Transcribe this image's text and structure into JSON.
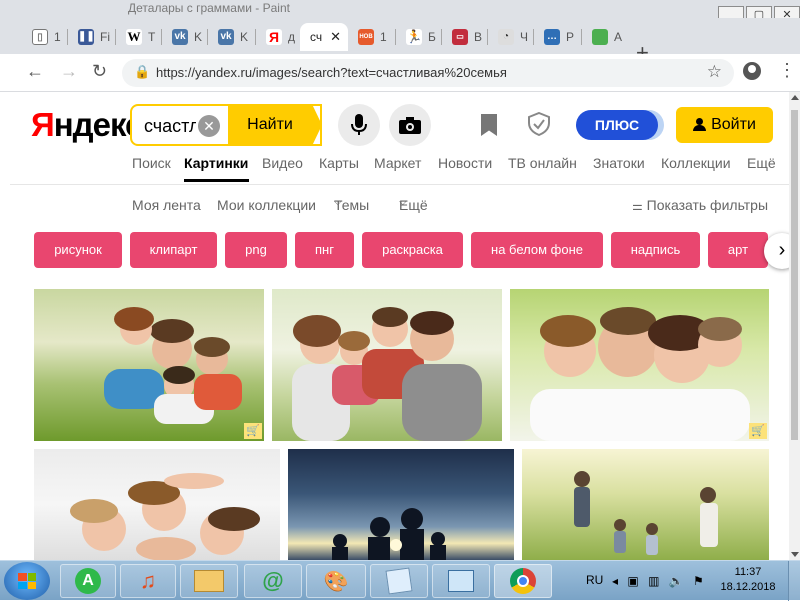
{
  "window": {
    "title_fragment": "Деталары с граммами - Paint",
    "controls": [
      "_",
      "▢",
      "✕"
    ]
  },
  "tabs": [
    {
      "label": "1",
      "icon": "document-icon",
      "color": "#777777"
    },
    {
      "label": "Fi",
      "icon": "pause-icon",
      "color": "#3b5998"
    },
    {
      "label": "T",
      "icon": "wikipedia-icon",
      "color": "#000000"
    },
    {
      "label": "K",
      "icon": "vk-icon",
      "color": "#4a76a8"
    },
    {
      "label": "K",
      "icon": "vk-icon",
      "color": "#4a76a8"
    },
    {
      "label": "д",
      "icon": "yandex-icon",
      "color": "#ff0000"
    },
    {
      "label": "сч",
      "icon": "",
      "color": "#ffffff",
      "active": true
    },
    {
      "label": "1",
      "icon": "news-icon",
      "color": "#e65a2c"
    },
    {
      "label": "Б",
      "icon": "runner-icon",
      "color": "#111111"
    },
    {
      "label": "В",
      "icon": "tv-icon",
      "color": "#c22d3d"
    },
    {
      "label": "Ч",
      "icon": "wolf-icon",
      "color": "#555555"
    },
    {
      "label": "Р",
      "icon": "chat-icon",
      "color": "#2f6fb6"
    },
    {
      "label": "А",
      "icon": "green-square-icon",
      "color": "#4caf50"
    }
  ],
  "address_bar": {
    "url": "https://yandex.ru/images/search?text=счастливая%20семья"
  },
  "header": {
    "logo_first": "Я",
    "logo_rest": "ндекс",
    "search_query": "счастл",
    "find_label": "Найти",
    "plus_label": "ПЛЮС",
    "login_label": "Войти"
  },
  "services": [
    {
      "label": "Поиск"
    },
    {
      "label": "Картинки",
      "active": true
    },
    {
      "label": "Видео"
    },
    {
      "label": "Карты"
    },
    {
      "label": "Маркет"
    },
    {
      "label": "Новости"
    },
    {
      "label": "ТВ онлайн"
    },
    {
      "label": "Знатоки"
    },
    {
      "label": "Коллекции"
    },
    {
      "label": "Ещё"
    }
  ],
  "subnav": {
    "feed": "Моя лента",
    "collections": "Мои коллекции",
    "themes": "Темы",
    "more": "Ещё",
    "filters": "Показать фильтры"
  },
  "tags": [
    "рисунок",
    "клипарт",
    "png",
    "пнг",
    "раскраска",
    "на белом фоне",
    "надпись",
    "арт"
  ],
  "taskbar": {
    "lang": "RU",
    "time": "11:37",
    "date": "18.12.2018"
  },
  "colors": {
    "yandex_yellow": "#ffcc00",
    "tag_pink": "#e9466f",
    "plus_blue": "#2150d8"
  }
}
